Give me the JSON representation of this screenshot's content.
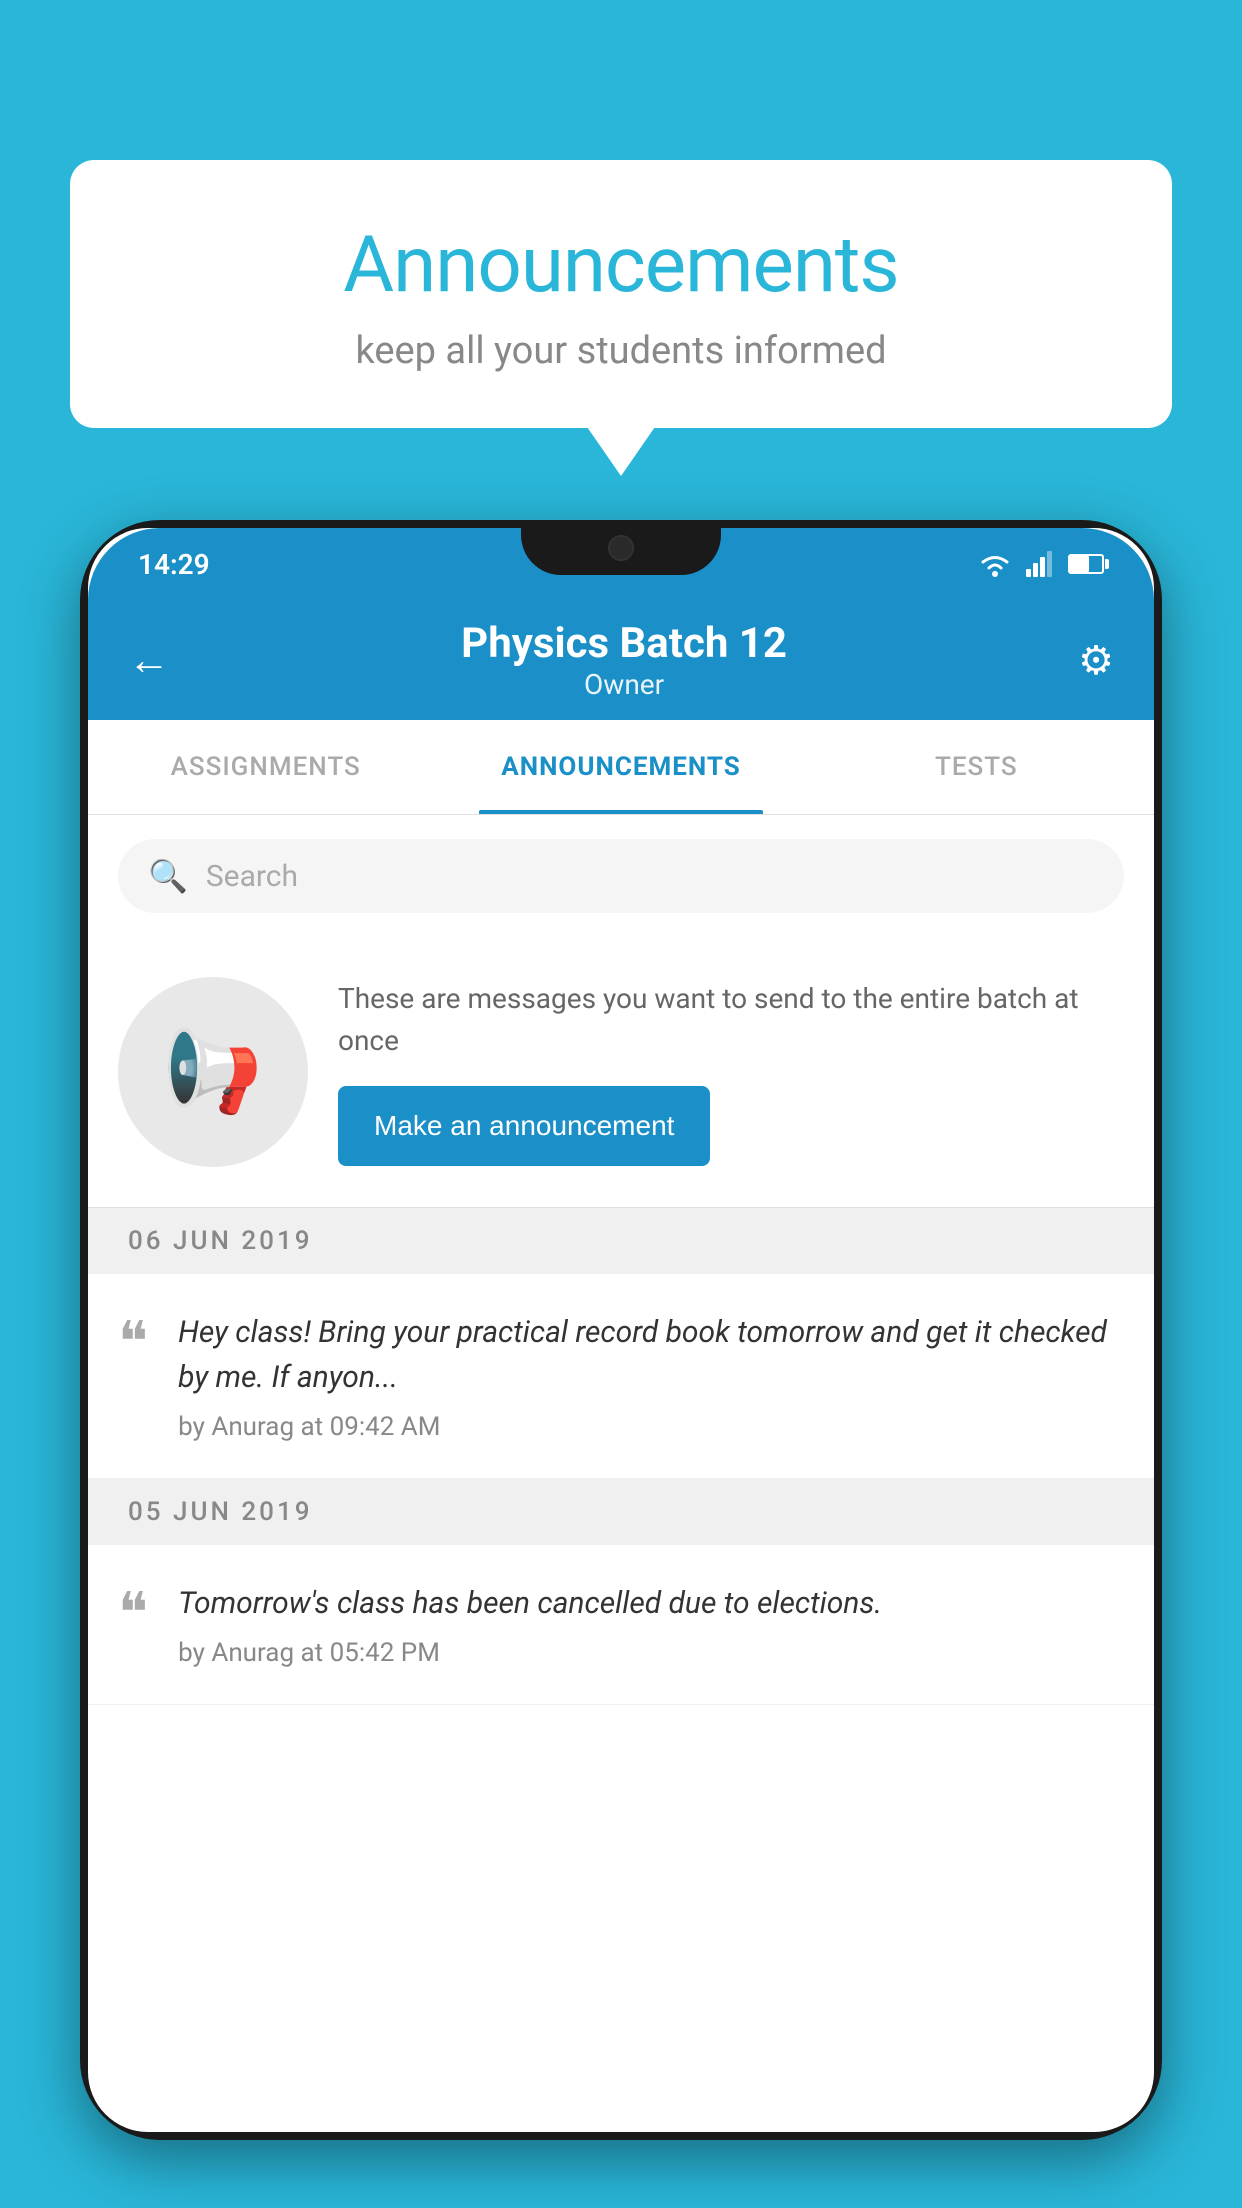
{
  "background_color": "#29b6d8",
  "speech_bubble": {
    "title": "Announcements",
    "subtitle": "keep all your students informed"
  },
  "status_bar": {
    "time": "14:29"
  },
  "app_bar": {
    "title": "Physics Batch 12",
    "subtitle": "Owner",
    "back_label": "←",
    "settings_label": "⚙"
  },
  "tabs": [
    {
      "label": "ASSIGNMENTS",
      "active": false
    },
    {
      "label": "ANNOUNCEMENTS",
      "active": true
    },
    {
      "label": "TESTS",
      "active": false
    }
  ],
  "search": {
    "placeholder": "Search"
  },
  "promo": {
    "description": "These are messages you want to send to the entire batch at once",
    "button_label": "Make an announcement"
  },
  "announcements": [
    {
      "date": "06  JUN  2019",
      "message": "Hey class! Bring your practical record book tomorrow and get it checked by me. If anyon...",
      "meta": "by Anurag at 09:42 AM"
    },
    {
      "date": "05  JUN  2019",
      "message": "Tomorrow's class has been cancelled due to elections.",
      "meta": "by Anurag at 05:42 PM"
    }
  ]
}
